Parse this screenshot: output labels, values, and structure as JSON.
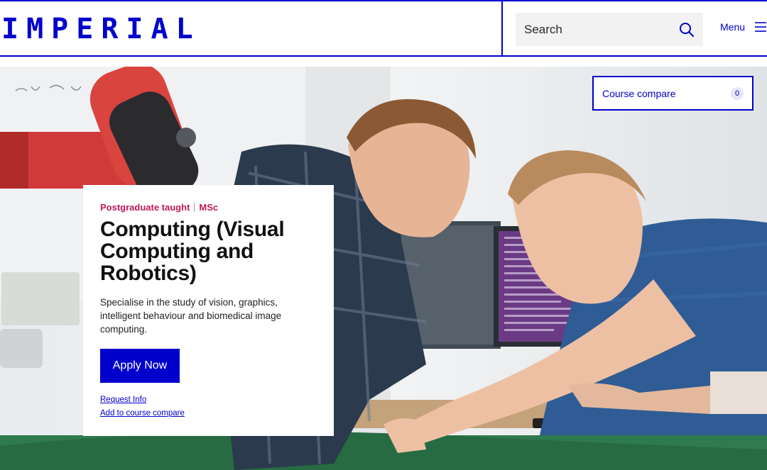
{
  "header": {
    "logo": "IMPERIAL",
    "search": {
      "placeholder": "Search",
      "icon": "search-icon"
    },
    "menu": {
      "label": "Menu",
      "icon": "hamburger-icon"
    },
    "accent_color": "#0000cd"
  },
  "compare": {
    "label": "Course compare",
    "count": "0"
  },
  "hero": {
    "image": "photo of two researchers working with a red robotic arm at a lab bench with monitors",
    "kicker_type": "Postgraduate taught",
    "kicker_degree": "MSc",
    "title": "Computing (Visual Computing and Robotics)",
    "description": "Specialise in the study of vision, graphics, intelligent behaviour and biomedical image computing.",
    "apply_label": "Apply Now",
    "links": [
      "Request Info",
      "Add to course compare"
    ],
    "kicker_color": "#c2185b"
  }
}
